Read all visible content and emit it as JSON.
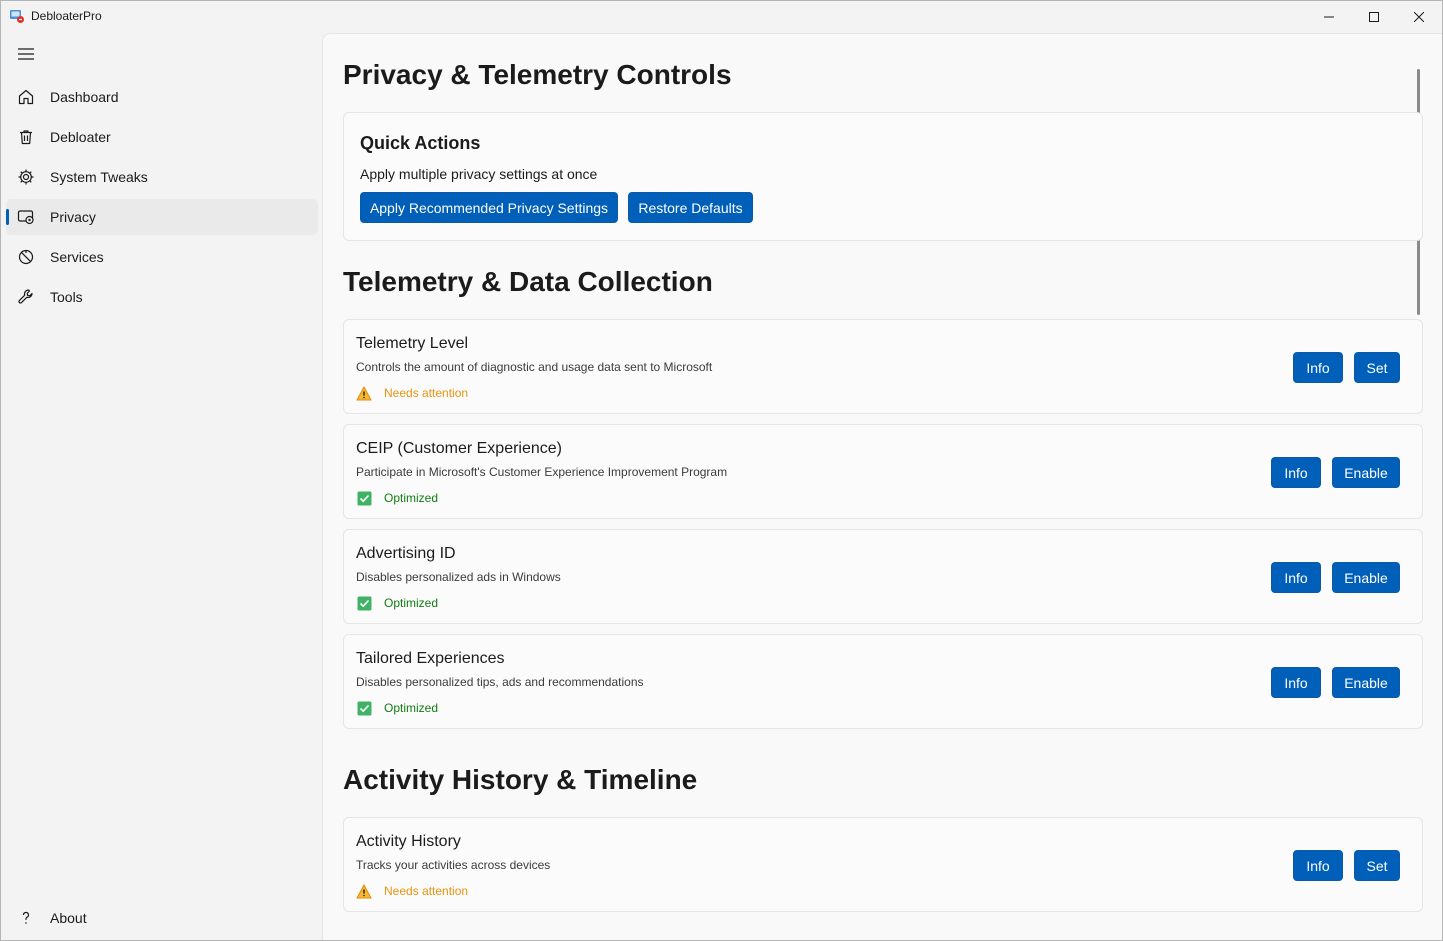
{
  "window": {
    "title": "DebloaterPro"
  },
  "sidebar": {
    "items": [
      {
        "label": "Dashboard",
        "icon": "home-icon"
      },
      {
        "label": "Debloater",
        "icon": "trash-icon"
      },
      {
        "label": "System Tweaks",
        "icon": "gear-icon"
      },
      {
        "label": "Privacy",
        "icon": "privacy-icon",
        "selected": true
      },
      {
        "label": "Services",
        "icon": "services-icon"
      },
      {
        "label": "Tools",
        "icon": "wrench-icon"
      }
    ],
    "footer": {
      "label": "About",
      "icon": "question-icon"
    }
  },
  "page": {
    "title": "Privacy & Telemetry Controls"
  },
  "quick_actions": {
    "title": "Quick Actions",
    "description": "Apply multiple privacy settings at once",
    "apply_label": "Apply Recommended Privacy Settings",
    "restore_label": "Restore Defaults"
  },
  "sections": [
    {
      "title": "Telemetry & Data Collection",
      "settings": [
        {
          "title": "Telemetry Level",
          "description": "Controls the amount of diagnostic and usage data sent to Microsoft",
          "status": "Needs attention",
          "status_type": "warning",
          "info_label": "Info",
          "action_label": "Set"
        },
        {
          "title": "CEIP (Customer Experience)",
          "description": "Participate in Microsoft's Customer Experience Improvement Program",
          "status": "Optimized",
          "status_type": "ok",
          "info_label": "Info",
          "action_label": "Enable"
        },
        {
          "title": "Advertising ID",
          "description": "Disables personalized ads in Windows",
          "status": "Optimized",
          "status_type": "ok",
          "info_label": "Info",
          "action_label": "Enable"
        },
        {
          "title": "Tailored Experiences",
          "description": "Disables personalized tips, ads and recommendations",
          "status": "Optimized",
          "status_type": "ok",
          "info_label": "Info",
          "action_label": "Enable"
        }
      ]
    },
    {
      "title": "Activity History & Timeline",
      "settings": [
        {
          "title": "Activity History",
          "description": "Tracks your activities across devices",
          "status": "Needs attention",
          "status_type": "warning",
          "info_label": "Info",
          "action_label": "Set"
        }
      ]
    }
  ],
  "colors": {
    "accent": "#005fb8",
    "warning": "#e8940c",
    "ok": "#107c10"
  }
}
